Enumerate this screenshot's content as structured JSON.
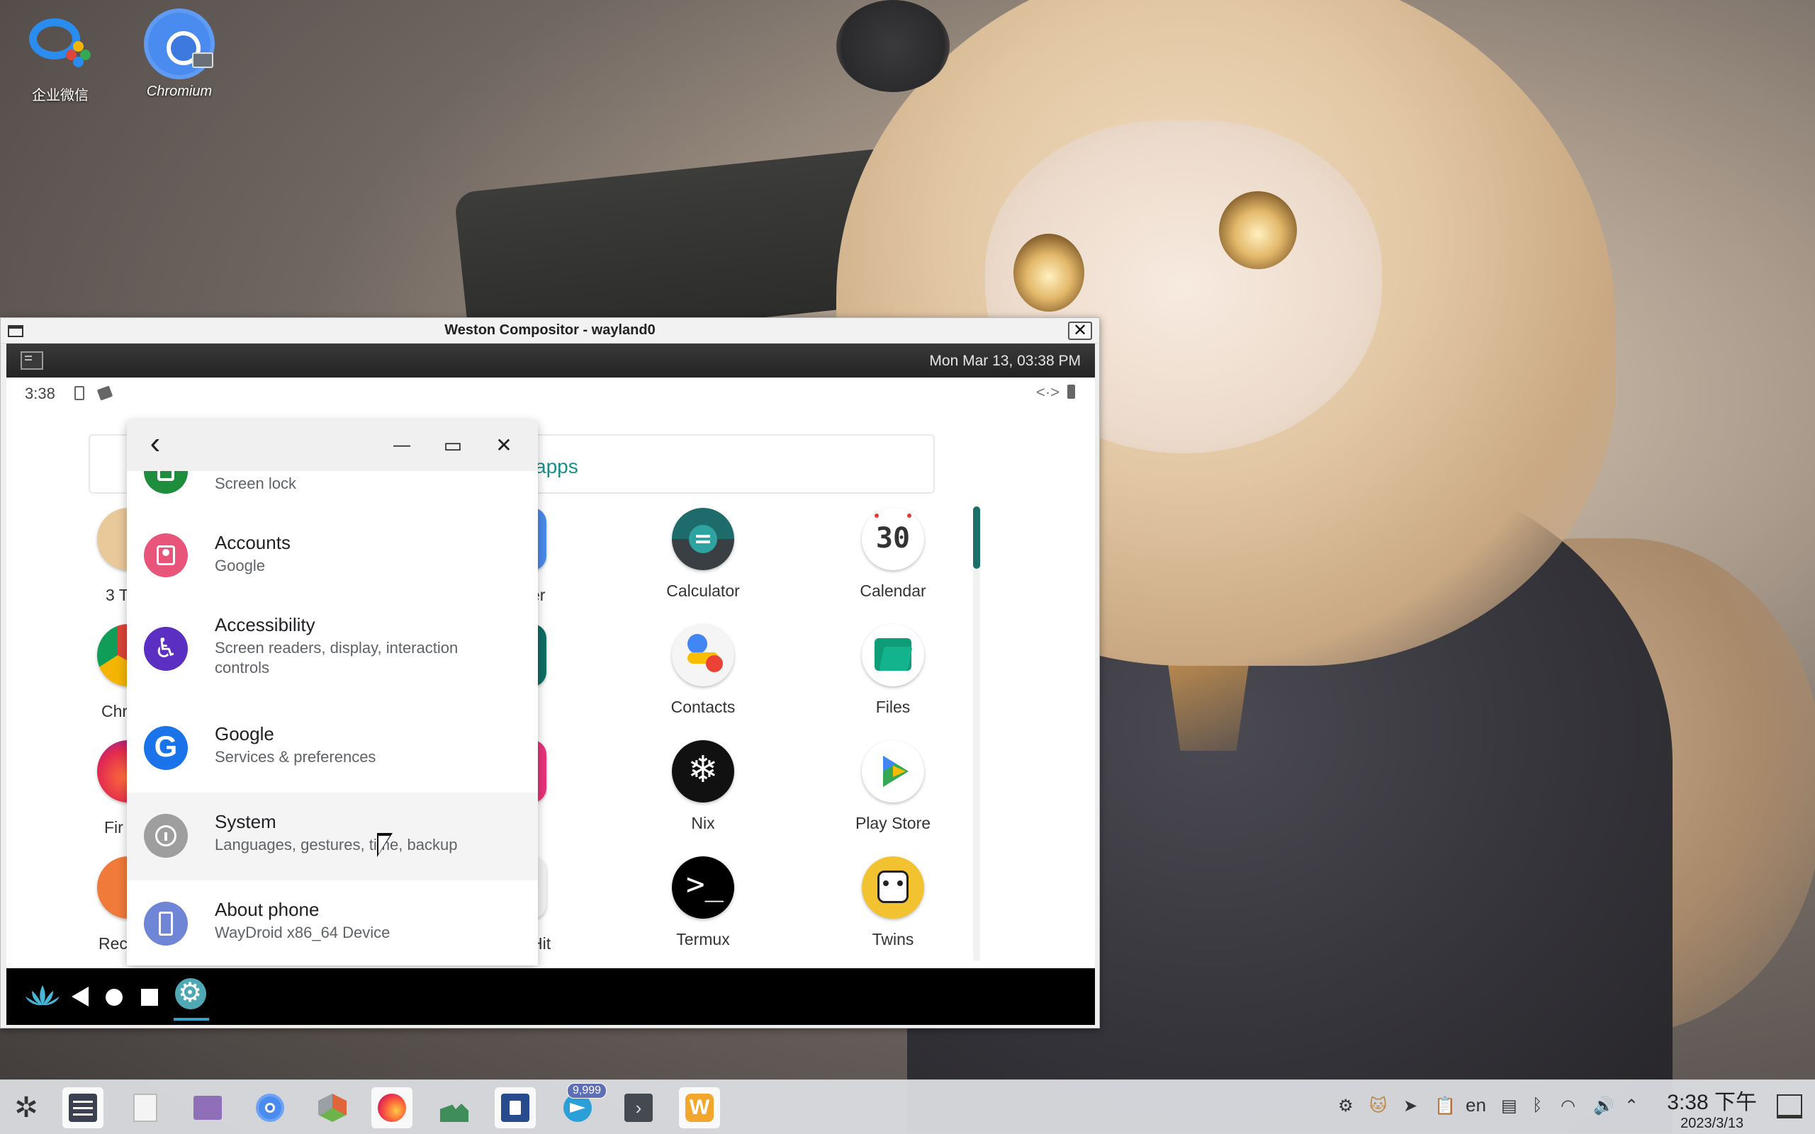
{
  "desktop": {
    "icons": [
      {
        "label": "企业微信",
        "icon": "wecom-icon"
      },
      {
        "label": "Chromium",
        "icon": "chromium-icon"
      }
    ]
  },
  "weston": {
    "title": "Weston Compositor - wayland0",
    "close_glyph": "✕",
    "panel_clock": "Mon Mar 13, 03:38 PM"
  },
  "android": {
    "status_time": "3:38",
    "status_ethernet_glyph": "<·>",
    "drawer": {
      "search_text": "apps",
      "apps": [
        {
          "label": "Calculator",
          "icon": "calculator-icon"
        },
        {
          "label": "Calendar",
          "icon": "calendar-icon",
          "day": "30"
        },
        {
          "label": "Contacts",
          "icon": "contacts-icon"
        },
        {
          "label": "Files",
          "icon": "files-icon"
        },
        {
          "label": "Nix",
          "icon": "nix-icon"
        },
        {
          "label": "Play Store",
          "icon": "play-store-icon"
        },
        {
          "label": "Termux",
          "icon": "termux-icon"
        },
        {
          "label": "Twins",
          "icon": "twins-icon"
        }
      ],
      "partial_labels": {
        "three_t": "3 T",
        "chr": "Chr",
        "fir": "Fir",
        "rec": "Rec",
        "er": "er",
        "hit": "Hit"
      }
    },
    "settings": {
      "caption": {
        "back": "‹",
        "minimize": "—",
        "maximize": "▭",
        "close": "✕"
      },
      "items": [
        {
          "title": "",
          "subtitle": "Screen lock",
          "icon": "security-icon",
          "color": "#1e8e3e"
        },
        {
          "title": "Accounts",
          "subtitle": "Google",
          "icon": "accounts-icon",
          "color": "#e8547a"
        },
        {
          "title": "Accessibility",
          "subtitle": "Screen readers, display, interaction controls",
          "icon": "accessibility-icon",
          "color": "#5a2fc2"
        },
        {
          "title": "Google",
          "subtitle": "Services & preferences",
          "icon": "google-icon",
          "color": "#1a73e8"
        },
        {
          "title": "System",
          "subtitle": "Languages, gestures, time, backup",
          "icon": "system-info-icon",
          "color": "#9e9e9e"
        },
        {
          "title": "About phone",
          "subtitle": "WayDroid x86_64 Device",
          "icon": "about-phone-icon",
          "color": "#6f86d6"
        }
      ]
    }
  },
  "taskbar": {
    "apps": [
      {
        "icon": "app-launcher-icon"
      },
      {
        "icon": "system-settings-icon"
      },
      {
        "icon": "text-file-icon"
      },
      {
        "icon": "file-manager-icon"
      },
      {
        "icon": "chromium-icon"
      },
      {
        "icon": "cube-app-icon"
      },
      {
        "icon": "firefox-icon"
      },
      {
        "icon": "image-viewer-icon"
      },
      {
        "icon": "waydroid-app-icon"
      },
      {
        "icon": "telegram-icon"
      },
      {
        "icon": "terminal-icon"
      },
      {
        "icon": "weston-icon"
      }
    ],
    "telegram_badge": "9,999",
    "tray": {
      "input_method": "en",
      "clock_time": "3:38 下午",
      "clock_date": "2023/3/13"
    }
  },
  "colors": {
    "accent_teal": "#1a8f86",
    "nav_underline": "#37a2c8"
  }
}
